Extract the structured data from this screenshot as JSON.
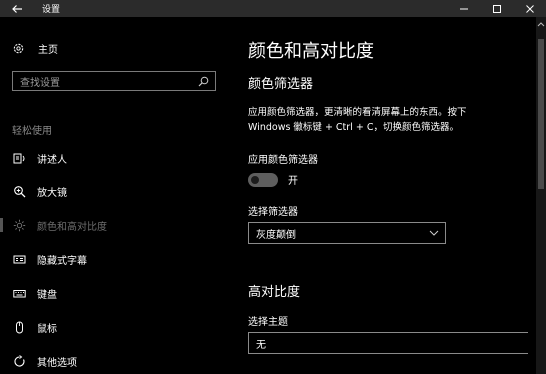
{
  "window": {
    "title": "设置",
    "back_icon": "back-arrow-icon",
    "controls": [
      "minimize-icon",
      "maximize-icon",
      "close-icon"
    ]
  },
  "sidebar": {
    "home_label": "主页",
    "search_placeholder": "查找设置",
    "section_label": "轻松使用",
    "items": [
      {
        "label": "讲述人",
        "icon": "narrator-icon"
      },
      {
        "label": "放大镜",
        "icon": "magnifier-icon"
      },
      {
        "label": "颜色和高对比度",
        "icon": "brightness-icon",
        "selected": true
      },
      {
        "label": "隐藏式字幕",
        "icon": "closed-captions-icon"
      },
      {
        "label": "键盘",
        "icon": "keyboard-icon"
      },
      {
        "label": "鼠标",
        "icon": "mouse-icon"
      },
      {
        "label": "其他选项",
        "icon": "other-options-icon"
      }
    ]
  },
  "main": {
    "page_title": "颜色和高对比度",
    "color_filter": {
      "heading": "颜色筛选器",
      "description_lines": [
        "应用颜色筛选器，更清晰的看清屏幕上的东西。按下",
        "Windows 徽标键 + Ctrl + C，切换颜色筛选器。"
      ],
      "toggle_label": "应用颜色筛选器",
      "toggle_state": "开",
      "select_label": "选择筛选器",
      "select_value": "灰度颠倒"
    },
    "high_contrast": {
      "heading": "高对比度",
      "theme_label": "选择主题",
      "theme_value": "无"
    }
  },
  "colors": {
    "background": "#000000",
    "titlebar": "#2b2b2b",
    "toggle_track": "#5e5e5e",
    "selected_text": "#6e6e6e"
  }
}
